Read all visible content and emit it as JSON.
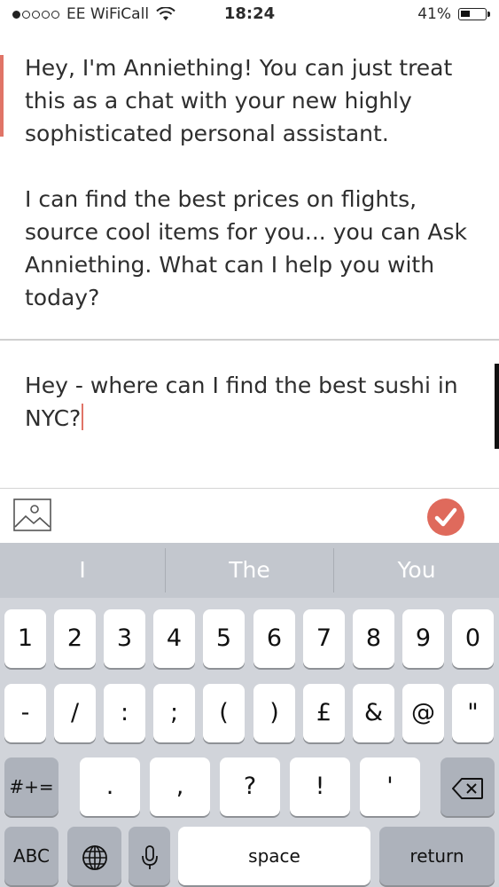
{
  "status_bar": {
    "carrier": "EE WiFiCall",
    "time": "18:24",
    "battery": "41%",
    "battery_level": 0.41
  },
  "conversation": {
    "assistant_message": [
      "Hey, I'm Anniething! You can just treat this as a chat with your new highly sophisticated personal assistant.",
      "I can find the best prices on flights, source cool items for you... you can Ask Anniething. What can I help you with today?"
    ]
  },
  "composer": {
    "input_value": "Hey - where can I find the best sushi in NYC?",
    "icons": {
      "image": "image-icon",
      "send": "checkmark-icon"
    },
    "accent_color": "#df6a5c"
  },
  "keyboard": {
    "suggestions": [
      "I",
      "The",
      "You"
    ],
    "row1": [
      "1",
      "2",
      "3",
      "4",
      "5",
      "6",
      "7",
      "8",
      "9",
      "0"
    ],
    "row2": [
      "-",
      "/",
      ":",
      ";",
      "(",
      ")",
      "£",
      "&",
      "@",
      "\""
    ],
    "row3_left": "#+=",
    "row3": [
      ".",
      ",",
      "?",
      "!",
      "'"
    ],
    "row3_right_icon": "backspace-icon",
    "row4": {
      "abc": "ABC",
      "globe_icon": "globe-icon",
      "mic_icon": "microphone-icon",
      "space": "space",
      "return": "return"
    }
  }
}
